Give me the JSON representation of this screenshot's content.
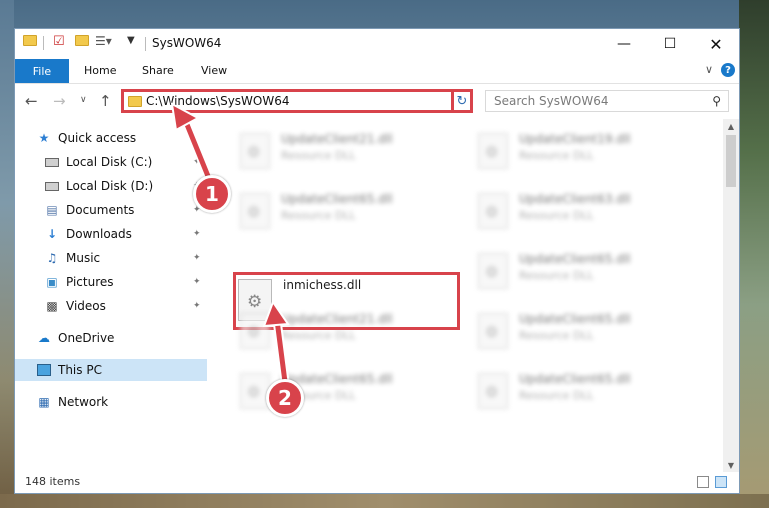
{
  "window": {
    "title": "SysWOW64"
  },
  "ribbon": {
    "tabs": [
      "File",
      "Home",
      "Share",
      "View"
    ],
    "help": "?"
  },
  "address": {
    "path": "C:\\Windows\\SysWOW64"
  },
  "search": {
    "placeholder": "Search SysWOW64"
  },
  "sidebar": {
    "items": [
      {
        "label": "Quick access",
        "icon": "star-icon"
      },
      {
        "label": "Local Disk (C:)",
        "icon": "drive-icon"
      },
      {
        "label": "Local Disk (D:)",
        "icon": "drive-icon"
      },
      {
        "label": "Documents",
        "icon": "documents-icon"
      },
      {
        "label": "Downloads",
        "icon": "download-icon"
      },
      {
        "label": "Music",
        "icon": "music-icon"
      },
      {
        "label": "Pictures",
        "icon": "pictures-icon"
      },
      {
        "label": "Videos",
        "icon": "videos-icon"
      },
      {
        "label": "OneDrive",
        "icon": "cloud-icon"
      },
      {
        "label": "This PC",
        "icon": "computer-icon"
      },
      {
        "label": "Network",
        "icon": "network-icon"
      }
    ]
  },
  "files": [
    {
      "name": "UpdateClient21.dll",
      "type": "Resource DLL"
    },
    {
      "name": "UpdateClient19.dll",
      "type": "Resource DLL"
    },
    {
      "name": "UpdateClient65.dll",
      "type": "Resource DLL"
    },
    {
      "name": "UpdateClient63.dll",
      "type": "Resource DLL"
    },
    {
      "name": "inmichess.dll",
      "type": ""
    },
    {
      "name": "UpdateClient65.dll",
      "type": "Resource DLL"
    },
    {
      "name": "UpdateClient21.dll",
      "type": "Resource DLL"
    },
    {
      "name": "UpdateClient65.dll",
      "type": "Resource DLL"
    },
    {
      "name": "UpdateClient65.dll",
      "type": "Resource DLL"
    },
    {
      "name": "UpdateClient65.dll",
      "type": "Resource DLL"
    }
  ],
  "status": {
    "item_count": "148 items"
  },
  "annotations": {
    "step1": "1",
    "step2": "2"
  },
  "colors": {
    "accent": "#1979ca",
    "highlight": "#d8434b",
    "selected": "#cce4f7"
  }
}
